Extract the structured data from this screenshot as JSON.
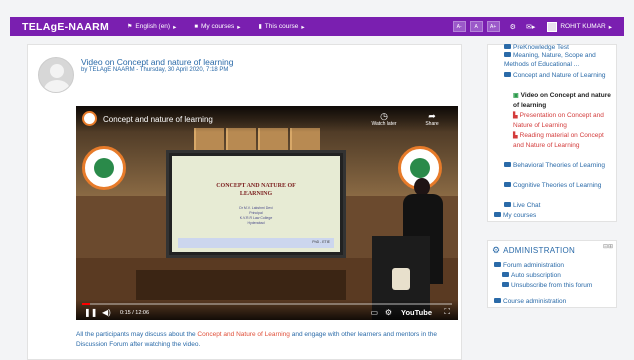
{
  "navbar": {
    "brand": "TELAgE-NAARM",
    "language": "English (en)",
    "my_courses": "My courses",
    "this_course": "This course",
    "font_buttons": [
      "A-",
      "A",
      "A+"
    ],
    "user_name": "ROHIT KUMAR",
    "icons": [
      "gear-icon",
      "message-icon"
    ]
  },
  "post": {
    "title": "Video on Concept and nature of learning",
    "meta": "by TELAgE NAARM - Thursday, 30 April 2020, 7:18 PM",
    "text_before": "All the participants may discuss about the ",
    "text_highlight": "Concept and Nature of Learning",
    "text_after": " and engage with other learners and mentors in the Discussion Forum after watching the video."
  },
  "video": {
    "title": "Concept and nature of learning",
    "watch_later": "Watch later",
    "share": "Share",
    "time": "0:15 / 12:06",
    "progress": 0.021,
    "brand": "YouTube",
    "slide_title": "CONCEPT AND NATURE OF LEARNING",
    "slide_presenter": "Dr M.V. Lakshmi Devi",
    "slide_role": "Principal",
    "slide_college": "K.V.R.R Law College",
    "slide_city": "Hyderabad",
    "slide_tag": "PhD - ETIE"
  },
  "sidebar": {
    "items": [
      "PreKnowledge Test",
      "Meaning, Nature, Scope and Methods of Educational ...",
      "Concept and Nature of Learning",
      "Video on Concept and nature of learning",
      "Presentation on Concept and Nature of Learning",
      "Reading material on Concept and Nature of Learning",
      "Behavioral Theories of Learning",
      "Cognitive Theories of Learning",
      "Live Chat",
      "My courses"
    ]
  },
  "admin": {
    "title": "ADMINISTRATION",
    "items": [
      "Forum administration",
      "Auto subscription",
      "Unsubscribe from this forum",
      "Course administration"
    ]
  },
  "colors": {
    "navbar": "#7a1fb0",
    "link": "#2a6aa8",
    "highlight": "#e0503a"
  }
}
